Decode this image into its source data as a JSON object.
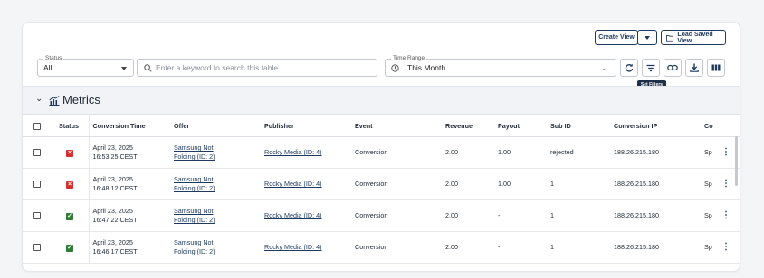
{
  "toolbar": {
    "create_view": "Create View",
    "load_saved_view": "Load Saved View"
  },
  "filters": {
    "status": {
      "label": "Status",
      "value": "All"
    },
    "search": {
      "placeholder": "Enter a keyword to search this table"
    },
    "time_range": {
      "label": "Time Range",
      "value": "This Month"
    },
    "tooltip": "Set Filters"
  },
  "metrics": {
    "title": "Metrics"
  },
  "table": {
    "headers": [
      "Status",
      "Conversion Time",
      "Offer",
      "Publisher",
      "Event",
      "Revenue",
      "Payout",
      "Sub ID",
      "Conversion IP",
      "Co"
    ],
    "rows": [
      {
        "status": "rejected",
        "time1": "April 23, 2025",
        "time2": "16:53:25 CEST",
        "offer1": "Samsung Not",
        "offer2": "Folding (ID: 2)",
        "publisher": "Rocky Media (ID: 4)",
        "event": "Conversion",
        "revenue": "2.00",
        "payout": "1.00",
        "sub_id": "rejected",
        "ip": "188.26.215.180",
        "co": "Sp"
      },
      {
        "status": "rejected",
        "time1": "April 23, 2025",
        "time2": "16:48:12 CEST",
        "offer1": "Samsung Not",
        "offer2": "Folding (ID: 2)",
        "publisher": "Rocky Media (ID: 4)",
        "event": "Conversion",
        "revenue": "2.00",
        "payout": "1.00",
        "sub_id": "1",
        "ip": "188.26.215.180",
        "co": "Sp"
      },
      {
        "status": "approved",
        "time1": "April 23, 2025",
        "time2": "16:47:22 CEST",
        "offer1": "Samsung Not",
        "offer2": "Folding (ID: 2)",
        "publisher": "Rocky Media (ID: 4)",
        "event": "Conversion",
        "revenue": "2.00",
        "payout": "-",
        "sub_id": "1",
        "ip": "188.26.215.180",
        "co": "Sp"
      },
      {
        "status": "approved",
        "time1": "April 23, 2025",
        "time2": "16:46:17 CEST",
        "offer1": "Samsung Not",
        "offer2": "Folding (ID: 2)",
        "publisher": "Rocky Media (ID: 4)",
        "event": "Conversion",
        "revenue": "2.00",
        "payout": "-",
        "sub_id": "1",
        "ip": "188.26.215.180",
        "co": "Sp"
      }
    ]
  },
  "colors": {
    "accent": "#1e3a5f",
    "rejected": "#d32f2f",
    "approved": "#2e7d32",
    "metrics_bg": "#f1f3f7"
  },
  "icons": {
    "create_view_dropdown": "caret-down-icon",
    "load_saved_view": "folder-icon",
    "search": "search-icon",
    "time_range": "clock-icon",
    "refresh": "refresh-icon",
    "filter": "filter-icon",
    "link": "link-icon",
    "download": "download-icon",
    "columns": "columns-icon",
    "metrics": "chart-icon",
    "row_menu": "kebab-icon"
  }
}
